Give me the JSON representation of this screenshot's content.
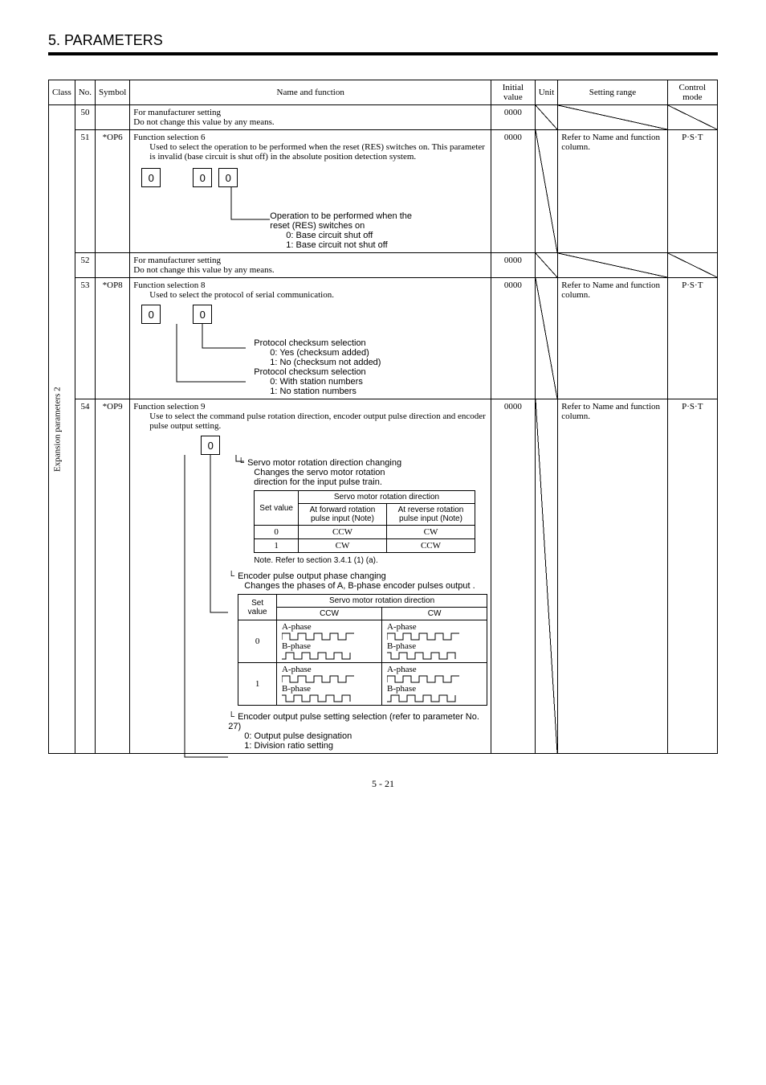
{
  "page": {
    "title": "5. PARAMETERS",
    "footer": "5 - 21"
  },
  "headers": {
    "class": "Class",
    "no": "No.",
    "symbol": "Symbol",
    "name": "Name and function",
    "initial": "Initial value",
    "unit": "Unit",
    "setting": "Setting range",
    "control": "Control mode"
  },
  "class_label": "Expansion parameters 2",
  "rows": {
    "r50": {
      "no": "50",
      "symbol": "",
      "lines": {
        "a": "For manufacturer setting",
        "b": "Do not change this value by any means."
      },
      "initial": "0000"
    },
    "r51": {
      "no": "51",
      "symbol": "*OP6",
      "title": "Function selection 6",
      "body": "Used to select the operation to be performed when the reset (RES) switches on. This parameter is invalid (base circuit is shut off) in the absolute position detection system.",
      "digits": {
        "d0": "0",
        "d2": "0",
        "d3": "0"
      },
      "callout": {
        "a": "Operation to be performed when the",
        "b": "reset (RES) switches on",
        "c": "0: Base circuit shut off",
        "d": "1: Base circuit not shut off"
      },
      "initial": "0000",
      "setting": "Refer to Name and function column.",
      "mode": "P·S·T"
    },
    "r52": {
      "no": "52",
      "symbol": "",
      "lines": {
        "a": "For manufacturer setting",
        "b": "Do not change this value by any means."
      },
      "initial": "0000"
    },
    "r53": {
      "no": "53",
      "symbol": "*OP8",
      "title": "Function selection 8",
      "body": "Used to select the protocol of serial communication.",
      "digits": {
        "d0": "0",
        "d2": "0"
      },
      "callout1": {
        "a": "Protocol checksum selection",
        "b": "0: Yes (checksum added)",
        "c": "1: No (checksum not added)"
      },
      "callout2": {
        "a": "Protocol checksum selection",
        "b": "0: With station numbers",
        "c": "1: No station numbers"
      },
      "initial": "0000",
      "setting": "Refer to Name and function column.",
      "mode": "P·S·T"
    },
    "r54": {
      "no": "54",
      "symbol": "*OP9",
      "title": "Function selection 9",
      "body": "Use to select the command pulse rotation direction, encoder output pulse direction and encoder pulse output setting.",
      "digits": {
        "d2": "0"
      },
      "cA": {
        "a": "Servo motor rotation direction changing",
        "b": "Changes the servo motor rotation",
        "c": "direction for the input pulse train."
      },
      "tblA": {
        "h_set": "Set value",
        "h_group": "Servo motor rotation direction",
        "h_fwd": "At forward rotation pulse input (Note)",
        "h_rev": "At reverse rotation pulse input (Note)",
        "r0": {
          "sv": "0",
          "fwd": "CCW",
          "rev": "CW"
        },
        "r1": {
          "sv": "1",
          "fwd": "CW",
          "rev": "CCW"
        },
        "note": "Note. Refer to section 3.4.1 (1) (a)."
      },
      "cB": {
        "a": "Encoder pulse output phase changing",
        "b": "Changes the phases of A, B-phase encoder pulses output ."
      },
      "tblB": {
        "h_set": "Set value",
        "h_group": "Servo motor rotation direction",
        "h_ccw": "CCW",
        "h_cw": "CW",
        "labA": "A-phase",
        "labB": "B-phase",
        "r0": "0",
        "r1": "1"
      },
      "cC": {
        "a": "Encoder output pulse setting selection (refer to parameter No. 27)",
        "b": "0: Output pulse designation",
        "c": "1: Division ratio setting"
      },
      "initial": "0000",
      "setting": "Refer to Name and function column.",
      "mode": "P·S·T"
    }
  }
}
